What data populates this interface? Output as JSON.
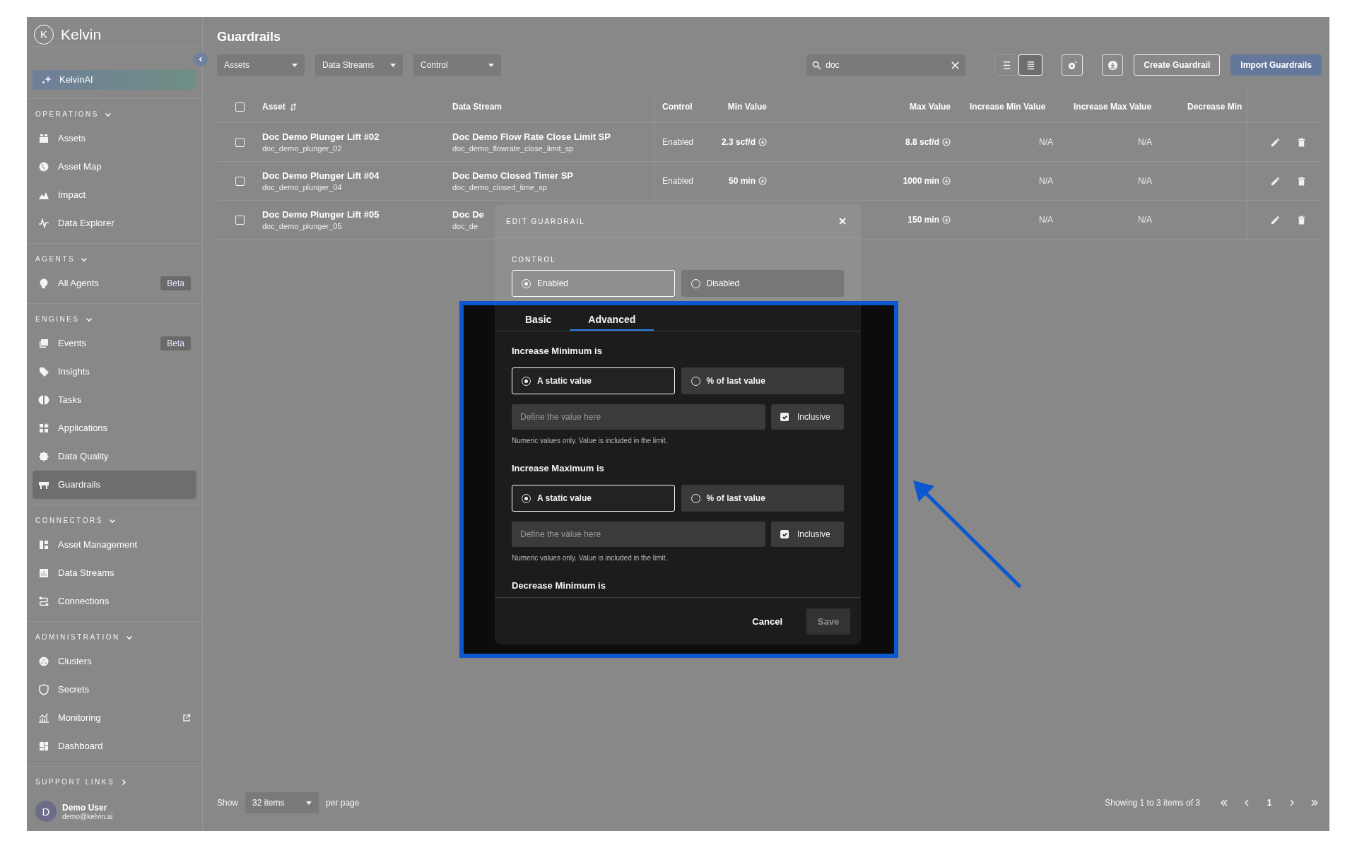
{
  "sidebar": {
    "logo": {
      "mark": "K",
      "text": "Kelvin"
    },
    "ai_item": {
      "label": "KelvinAI"
    },
    "sections": [
      {
        "title": "OPERATIONS",
        "expanded": true,
        "items": [
          {
            "label": "Assets",
            "selected": false
          },
          {
            "label": "Asset Map",
            "selected": false
          },
          {
            "label": "Impact",
            "selected": false
          },
          {
            "label": "Data Explorer",
            "selected": false
          }
        ]
      },
      {
        "title": "AGENTS",
        "expanded": true,
        "items": [
          {
            "label": "All Agents",
            "selected": false,
            "badge": "Beta"
          }
        ]
      },
      {
        "title": "ENGINES",
        "expanded": true,
        "items": [
          {
            "label": "Events",
            "selected": false,
            "badge": "Beta"
          },
          {
            "label": "Insights",
            "selected": false
          },
          {
            "label": "Tasks",
            "selected": false
          },
          {
            "label": "Applications",
            "selected": false
          },
          {
            "label": "Data Quality",
            "selected": false
          },
          {
            "label": "Guardrails",
            "selected": true
          }
        ]
      },
      {
        "title": "CONNECTORS",
        "expanded": true,
        "items": [
          {
            "label": "Asset Management",
            "selected": false
          },
          {
            "label": "Data Streams",
            "selected": false
          },
          {
            "label": "Connections",
            "selected": false
          }
        ]
      },
      {
        "title": "ADMINISTRATION",
        "expanded": true,
        "items": [
          {
            "label": "Clusters",
            "selected": false,
            "external": false
          },
          {
            "label": "Secrets",
            "selected": false,
            "external": false
          },
          {
            "label": "Monitoring",
            "selected": false,
            "external": true
          },
          {
            "label": "Dashboard",
            "selected": false,
            "external": false
          }
        ]
      },
      {
        "title": "SUPPORT LINKS",
        "expanded": false
      }
    ],
    "user": {
      "initial": "D",
      "name": "Demo User",
      "email": "demo@kelvin.ai"
    }
  },
  "page_title": "Guardrails",
  "filters": [
    {
      "placeholder": "Assets"
    },
    {
      "placeholder": "Data Streams"
    },
    {
      "placeholder": "Control"
    }
  ],
  "search": {
    "value": "doc"
  },
  "view_toggle": [
    {
      "selected": false
    },
    {
      "selected": true
    }
  ],
  "buttons": [
    {
      "label": "Create Guardrail",
      "kind": "outline"
    },
    {
      "label": "Import Guardrails",
      "kind": "primary"
    }
  ],
  "table": {
    "select_all_checked": false,
    "columns": [
      "Asset",
      "Data Stream",
      "Control",
      "Min Value",
      "Max Value",
      "Increase Min Value",
      "Increase Max Value",
      "Decrease Min"
    ],
    "rows": [
      {
        "checked": false,
        "asset": "Doc Demo Plunger Lift #02",
        "asset_id": "doc_demo_plunger_02",
        "stream": "Doc Demo Flow Rate Close Limit SP",
        "stream_id": "doc_demo_flowrate_close_limit_sp",
        "control": "Enabled",
        "min": "2.3 scf/d",
        "max": "8.8 scf/d",
        "increase_min": "N/A",
        "increase_max": "N/A"
      },
      {
        "checked": false,
        "asset": "Doc Demo Plunger Lift #04",
        "asset_id": "doc_demo_plunger_04",
        "stream": "Doc Demo Closed Timer SP",
        "stream_id": "doc_demo_closed_time_sp",
        "control": "Enabled",
        "min": "50 min",
        "max": "1000 min",
        "increase_min": "N/A",
        "increase_max": "N/A"
      },
      {
        "checked": false,
        "asset": "Doc Demo Plunger Lift #05",
        "asset_id": "doc_demo_plunger_05",
        "stream": "Doc De",
        "stream_id": "doc_de",
        "max": "150 min",
        "increase_min": "N/A",
        "increase_max": "N/A"
      }
    ]
  },
  "pagination": {
    "show_label": "Show",
    "page_size": "32 items",
    "per_page_label": "per page",
    "summary": "Showing 1 to 3 items of 3",
    "current_page": "1"
  },
  "dialog": {
    "title": "EDIT GUARDRAIL",
    "control": {
      "label": "CONTROL",
      "options": [
        {
          "label": "Enabled",
          "selected": true
        },
        {
          "label": "Disabled",
          "selected": false
        }
      ]
    },
    "tabs": [
      {
        "label": "Basic",
        "selected": false
      },
      {
        "label": "Advanced",
        "selected": true
      }
    ],
    "sections": [
      {
        "title": "Increase Minimum is",
        "options": [
          {
            "label": "A static value",
            "selected": true
          },
          {
            "label": "% of last value",
            "selected": false
          }
        ],
        "field": {
          "placeholder": "Define the value here"
        },
        "inclusive": {
          "label": "Inclusive",
          "checked": true
        },
        "help": "Numeric values only. Value is included in the limit."
      },
      {
        "title": "Increase Maximum is",
        "options": [
          {
            "label": "A static value",
            "selected": true
          },
          {
            "label": "% of last value",
            "selected": false
          }
        ],
        "field": {
          "placeholder": "Define the value here"
        },
        "inclusive": {
          "label": "Inclusive",
          "checked": true
        },
        "help": "Numeric values only. Value is included in the limit."
      },
      {
        "title": "Decrease Minimum is"
      }
    ],
    "buttons": [
      {
        "label": "Cancel",
        "kind": "text",
        "disabled": false
      },
      {
        "label": "Save",
        "kind": "primary",
        "disabled": true
      }
    ]
  },
  "annotation": {
    "highlight": true,
    "arrow": true
  }
}
